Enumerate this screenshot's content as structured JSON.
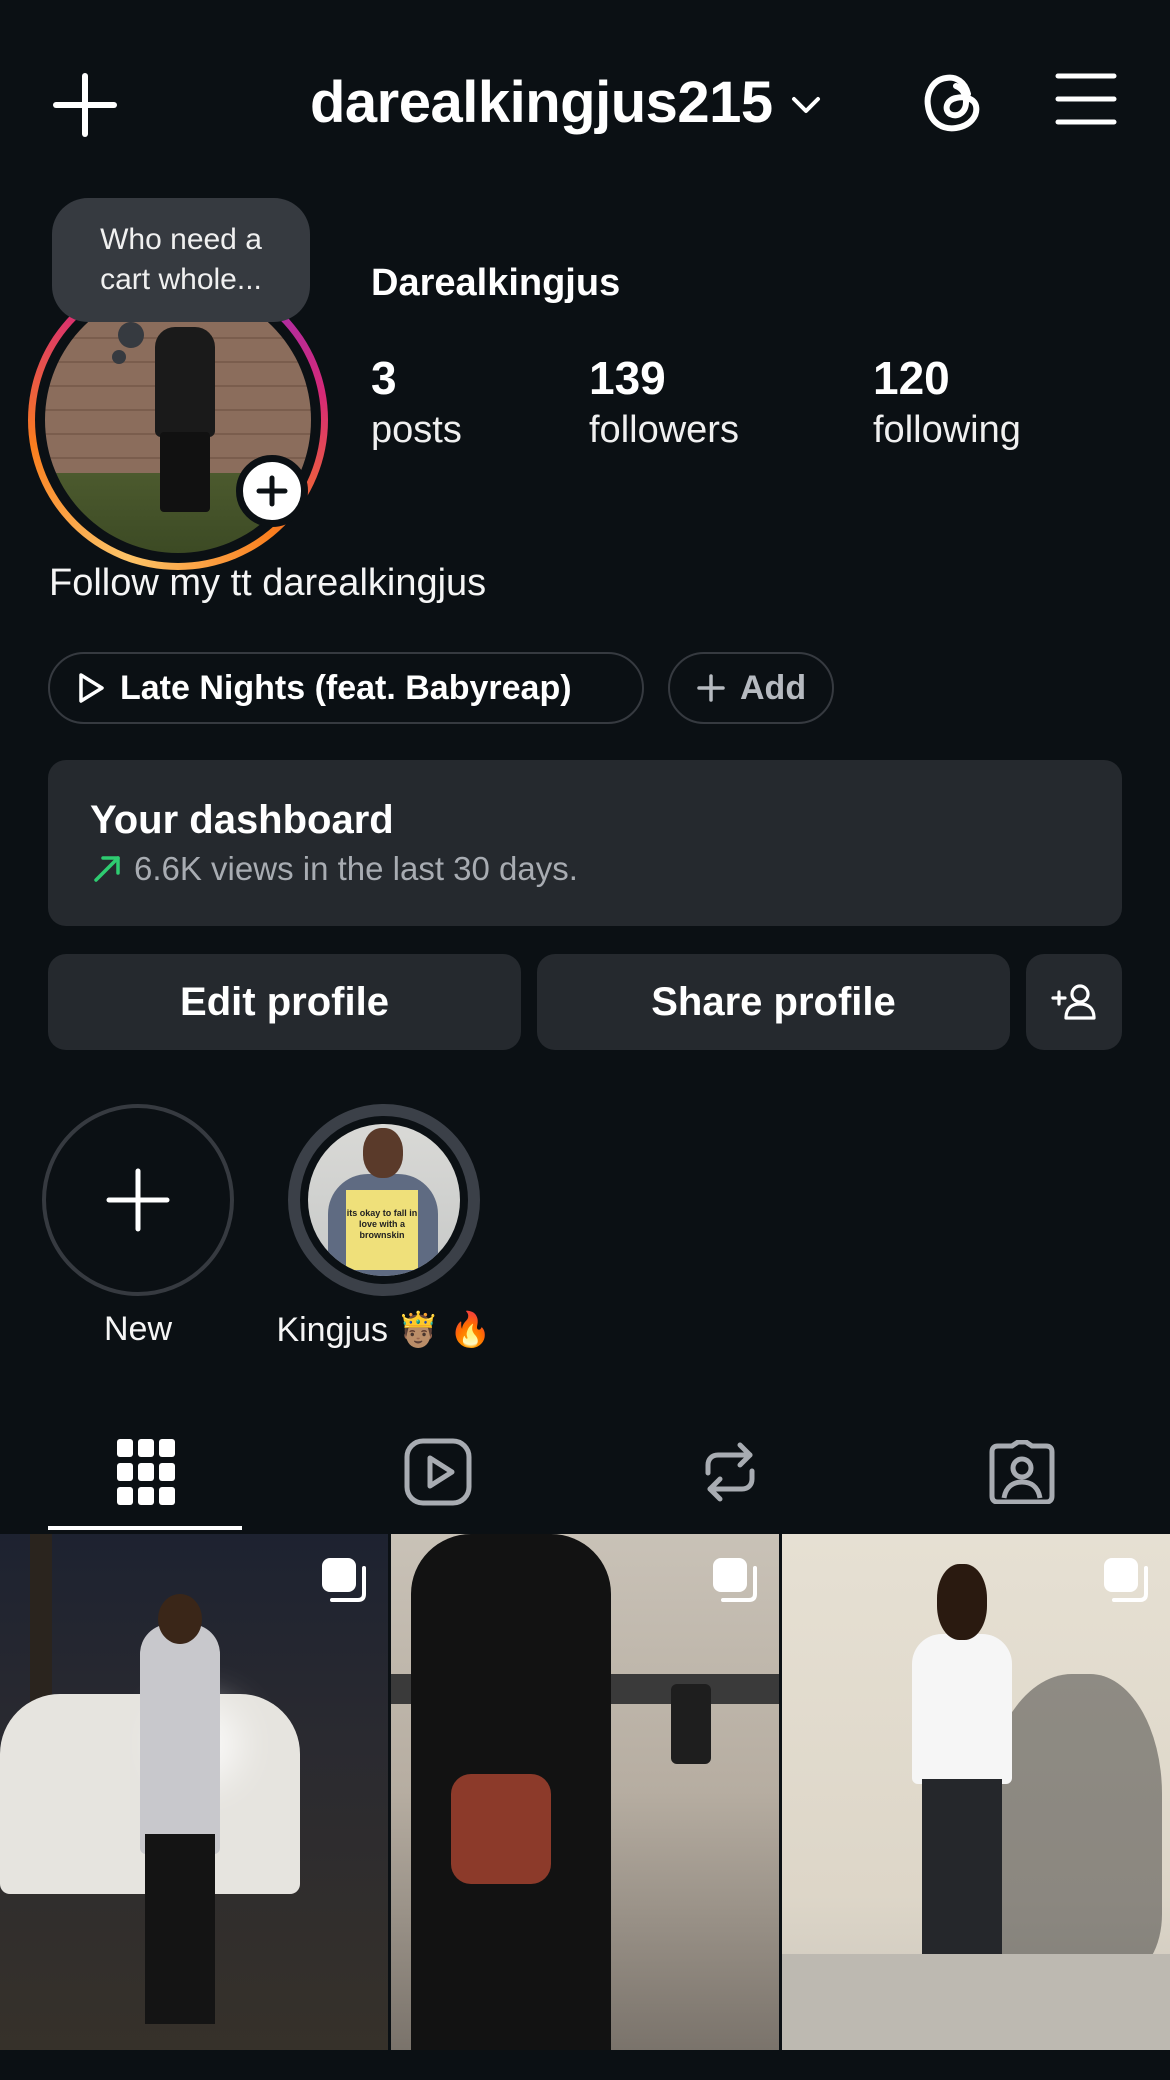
{
  "header": {
    "username": "darealkingjus215",
    "icons": {
      "create": "plus-icon",
      "account_switch": "chevron-down-icon",
      "threads": "threads-icon",
      "menu": "hamburger-menu-icon"
    }
  },
  "note": {
    "text": "Who need a cart whole..."
  },
  "profile": {
    "display_name": "Darealkingjus",
    "stats": [
      {
        "value": "3",
        "label": "posts"
      },
      {
        "value": "139",
        "label": "followers"
      },
      {
        "value": "120",
        "label": "following"
      }
    ],
    "bio": "Follow my tt darealkingjus"
  },
  "pills": {
    "music": "Late Nights (feat. Babyreap)",
    "add": "Add"
  },
  "dashboard": {
    "title": "Your dashboard",
    "subtitle": "6.6K views in the last 30 days."
  },
  "buttons": {
    "edit": "Edit profile",
    "share": "Share profile"
  },
  "highlights": [
    {
      "label": "New"
    },
    {
      "label": "Kingjus 🤴🏽 🔥",
      "sign_text": "its okay to fall in love with a brownskin"
    }
  ],
  "tabs": [
    "posts-grid-icon",
    "reels-icon",
    "reposts-icon",
    "tagged-icon"
  ],
  "colors": {
    "background": "#0b1014",
    "surface": "#25292e",
    "accent_green": "#2ecc71"
  }
}
